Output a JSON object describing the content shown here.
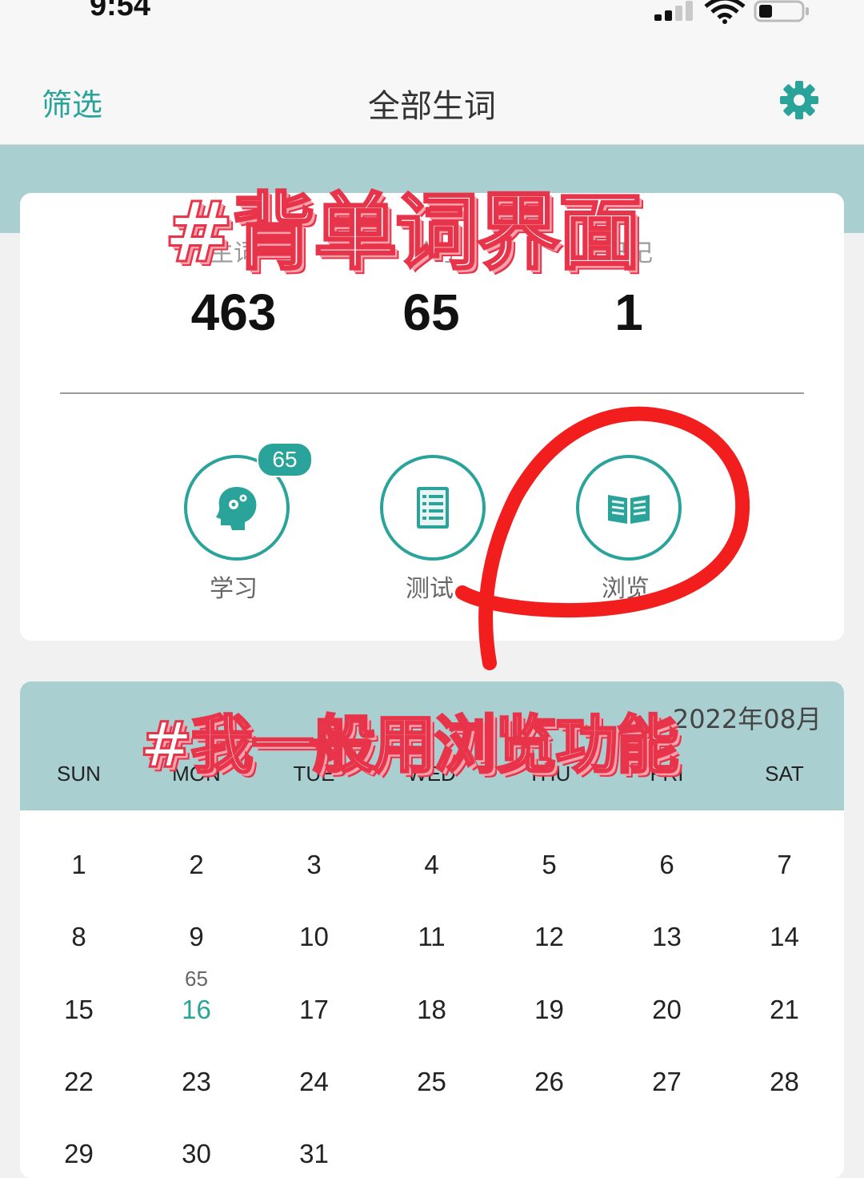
{
  "status_bar": {
    "time": "9:54"
  },
  "nav": {
    "filter_label": "筛选",
    "title": "全部生词",
    "settings_icon": "gear-icon"
  },
  "stats": [
    {
      "label": "生词",
      "value": "463"
    },
    {
      "label": "学习",
      "value": "65"
    },
    {
      "label": "已记",
      "value": "1"
    }
  ],
  "actions": [
    {
      "label": "学习",
      "icon": "brain-gear-icon",
      "badge": "65"
    },
    {
      "label": "测试",
      "icon": "checklist-icon"
    },
    {
      "label": "浏览",
      "icon": "open-book-icon"
    }
  ],
  "calendar": {
    "month_label": "2022年08月",
    "weekdays": [
      "SUN",
      "MON",
      "TUE",
      "WED",
      "THU",
      "FRI",
      "SAT"
    ],
    "weeks": [
      [
        "1",
        "2",
        "3",
        "4",
        "5",
        "6",
        "7"
      ],
      [
        "8",
        "9",
        "10",
        "11",
        "12",
        "13",
        "14"
      ],
      [
        "15",
        "16",
        "17",
        "18",
        "19",
        "20",
        "21"
      ],
      [
        "22",
        "23",
        "24",
        "25",
        "26",
        "27",
        "28"
      ],
      [
        "29",
        "30",
        "31",
        "",
        "",
        "",
        ""
      ]
    ],
    "today": "16",
    "today_count": "65"
  },
  "overlays": {
    "headline": "#背单词界面",
    "caption": "#我一般用浏览功能"
  },
  "colors": {
    "accent": "#2aa39a",
    "band": "#a9cfd0",
    "annotation": "#e8344a"
  }
}
